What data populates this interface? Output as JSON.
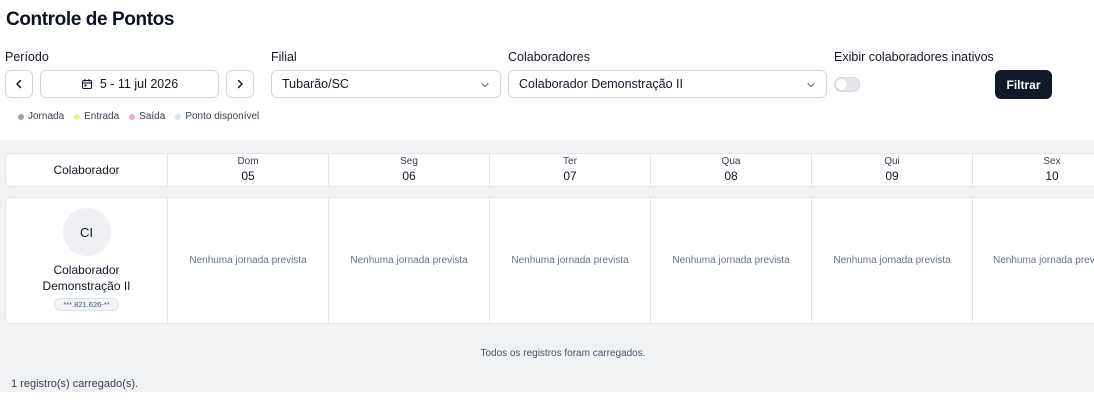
{
  "page": {
    "title": "Controle de Pontos"
  },
  "filters": {
    "period_label": "Período",
    "period_value": "5 - 11 jul 2026",
    "branch_label": "Filial",
    "branch_value": "Tubarão/SC",
    "employees_label": "Colaboradores",
    "employees_value": "Colaborador Demonstração II",
    "inactive_label": "Exibir colaboradores inativos",
    "inactive_enabled": false,
    "filter_button": "Filtrar"
  },
  "legend": [
    {
      "label": "Jornada",
      "color": "#9ca3af"
    },
    {
      "label": "Entrada",
      "color": "#d9f99d"
    },
    {
      "label": "Saída",
      "color": "#f9a8d4"
    },
    {
      "label": "Ponto disponível",
      "color": "#cfe3f0"
    }
  ],
  "table": {
    "employee_header": "Colaborador",
    "days": [
      {
        "name": "Dom",
        "date": "05"
      },
      {
        "name": "Seg",
        "date": "06"
      },
      {
        "name": "Ter",
        "date": "07"
      },
      {
        "name": "Qua",
        "date": "08"
      },
      {
        "name": "Qui",
        "date": "09"
      },
      {
        "name": "Sex",
        "date": "10"
      }
    ],
    "rows": [
      {
        "initials": "CI",
        "name_line1": "Colaborador",
        "name_line2": "Demonstração II",
        "document": "***.821.626-**",
        "slots": [
          "Nenhuma jornada prevista",
          "Nenhuma jornada prevista",
          "Nenhuma jornada prevista",
          "Nenhuma jornada prevista",
          "Nenhuma jornada prevista",
          "Nenhuma jornada prevista"
        ]
      }
    ]
  },
  "footer": {
    "all_loaded": "Todos os registros foram carregados.",
    "records_count": "1 registro(s) carregado(s)."
  }
}
